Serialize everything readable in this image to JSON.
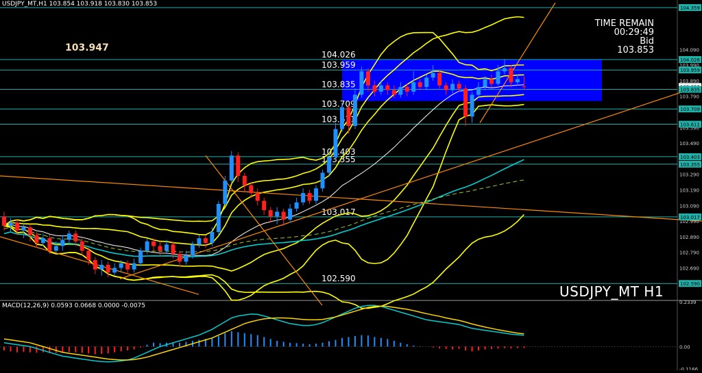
{
  "header": {
    "symbol_info": "USDJPY_MT,H1  103.854 103.918 103.830 103.853",
    "macd_info": "MACD(12,26,9) 0.0593 0.0668 0.0000 -0.0075"
  },
  "overlay": {
    "big_price": "103.947",
    "time_remain_label": "TIME REMAIN",
    "time_remain_value": "00:29:49",
    "bid_label": "Bid",
    "bid_value": "103.853",
    "symbol_label": "USDJPY_MT H1"
  },
  "colors": {
    "background": "#000000",
    "bull": "#1e90ff",
    "bear": "#ff2020",
    "bollinger": "#ffff00",
    "level_line": "#20b2aa",
    "trend_line": "#ff8c00",
    "ma_cyan": "#00ced1",
    "macd_histogram_pos": "#1e90ff",
    "macd_histogram_neg": "#ff2020",
    "highlight_box": "#0000ff"
  },
  "chart_data": [
    {
      "type": "candlestick",
      "title": "USDJPY_MT H1",
      "ylim": [
        102.49,
        104.39
      ],
      "price_axis_ticks": [
        "104.359",
        "104.090",
        "103.990",
        "103.890",
        "103.790",
        "103.590",
        "103.490",
        "103.290",
        "103.190",
        "103.090",
        "102.990",
        "102.890",
        "102.790",
        "102.690"
      ],
      "level_lines": [
        {
          "value": 104.026,
          "label": "104.026"
        },
        {
          "value": 103.959,
          "label": "103.959"
        },
        {
          "value": 103.835,
          "label": "103.835"
        },
        {
          "value": 103.709,
          "label": "103.709"
        },
        {
          "value": 103.611,
          "label": "103.611"
        },
        {
          "value": 103.403,
          "label": "103.403"
        },
        {
          "value": 103.355,
          "label": "103.355"
        },
        {
          "value": 103.017,
          "label": "103.017"
        },
        {
          "value": 102.59,
          "label": "102.590"
        },
        {
          "value": 104.359,
          "label": "104.359"
        }
      ],
      "axis_level_boxes": [
        "104.359",
        "104.026",
        "103.959",
        "103.853",
        "103.835",
        "103.709",
        "103.611",
        "103.403",
        "103.355",
        "103.017",
        "102.590"
      ],
      "candles": [
        {
          "o": 103.02,
          "c": 102.96,
          "h": 103.05,
          "l": 102.93
        },
        {
          "o": 102.96,
          "c": 102.98,
          "h": 103.01,
          "l": 102.92
        },
        {
          "o": 102.98,
          "c": 102.93,
          "h": 103.0,
          "l": 102.9
        },
        {
          "o": 102.93,
          "c": 102.95,
          "h": 102.98,
          "l": 102.88
        },
        {
          "o": 102.95,
          "c": 102.9,
          "h": 102.97,
          "l": 102.86
        },
        {
          "o": 102.9,
          "c": 102.85,
          "h": 102.92,
          "l": 102.82
        },
        {
          "o": 102.85,
          "c": 102.88,
          "h": 102.91,
          "l": 102.83
        },
        {
          "o": 102.88,
          "c": 102.8,
          "h": 102.9,
          "l": 102.78
        },
        {
          "o": 102.8,
          "c": 102.83,
          "h": 102.86,
          "l": 102.78
        },
        {
          "o": 102.83,
          "c": 102.87,
          "h": 102.9,
          "l": 102.8
        },
        {
          "o": 102.87,
          "c": 102.91,
          "h": 102.93,
          "l": 102.85
        },
        {
          "o": 102.91,
          "c": 102.86,
          "h": 102.93,
          "l": 102.83
        },
        {
          "o": 102.86,
          "c": 102.8,
          "h": 102.88,
          "l": 102.77
        },
        {
          "o": 102.8,
          "c": 102.74,
          "h": 102.82,
          "l": 102.71
        },
        {
          "o": 102.74,
          "c": 102.68,
          "h": 102.76,
          "l": 102.65
        },
        {
          "o": 102.68,
          "c": 102.71,
          "h": 102.74,
          "l": 102.64
        },
        {
          "o": 102.71,
          "c": 102.66,
          "h": 102.73,
          "l": 102.63
        },
        {
          "o": 102.66,
          "c": 102.69,
          "h": 102.72,
          "l": 102.64
        },
        {
          "o": 102.69,
          "c": 102.72,
          "h": 102.74,
          "l": 102.66
        },
        {
          "o": 102.72,
          "c": 102.68,
          "h": 102.74,
          "l": 102.65
        },
        {
          "o": 102.68,
          "c": 102.72,
          "h": 102.75,
          "l": 102.66
        },
        {
          "o": 102.72,
          "c": 102.8,
          "h": 102.82,
          "l": 102.7
        },
        {
          "o": 102.8,
          "c": 102.86,
          "h": 102.88,
          "l": 102.78
        },
        {
          "o": 102.86,
          "c": 102.83,
          "h": 102.88,
          "l": 102.8
        },
        {
          "o": 102.83,
          "c": 102.8,
          "h": 102.86,
          "l": 102.77
        },
        {
          "o": 102.8,
          "c": 102.84,
          "h": 102.87,
          "l": 102.78
        },
        {
          "o": 102.84,
          "c": 102.78,
          "h": 102.86,
          "l": 102.75
        },
        {
          "o": 102.78,
          "c": 102.73,
          "h": 102.8,
          "l": 102.7
        },
        {
          "o": 102.73,
          "c": 102.77,
          "h": 102.8,
          "l": 102.71
        },
        {
          "o": 102.77,
          "c": 102.84,
          "h": 102.86,
          "l": 102.75
        },
        {
          "o": 102.84,
          "c": 102.88,
          "h": 102.9,
          "l": 102.82
        },
        {
          "o": 102.88,
          "c": 102.85,
          "h": 102.9,
          "l": 102.82
        },
        {
          "o": 102.85,
          "c": 102.92,
          "h": 102.95,
          "l": 102.83
        },
        {
          "o": 102.92,
          "c": 103.1,
          "h": 103.12,
          "l": 102.9
        },
        {
          "o": 103.1,
          "c": 103.25,
          "h": 103.28,
          "l": 103.08
        },
        {
          "o": 103.25,
          "c": 103.41,
          "h": 103.44,
          "l": 103.23
        },
        {
          "o": 103.41,
          "c": 103.28,
          "h": 103.43,
          "l": 103.24
        },
        {
          "o": 103.28,
          "c": 103.22,
          "h": 103.3,
          "l": 103.18
        },
        {
          "o": 103.22,
          "c": 103.17,
          "h": 103.24,
          "l": 103.14
        },
        {
          "o": 103.17,
          "c": 103.12,
          "h": 103.2,
          "l": 103.09
        },
        {
          "o": 103.12,
          "c": 103.06,
          "h": 103.14,
          "l": 103.03
        },
        {
          "o": 103.06,
          "c": 103.02,
          "h": 103.08,
          "l": 102.98
        },
        {
          "o": 103.02,
          "c": 103.05,
          "h": 103.08,
          "l": 102.97
        },
        {
          "o": 103.05,
          "c": 103.0,
          "h": 103.07,
          "l": 102.96
        },
        {
          "o": 103.0,
          "c": 103.07,
          "h": 103.1,
          "l": 102.98
        },
        {
          "o": 103.07,
          "c": 103.11,
          "h": 103.14,
          "l": 103.05
        },
        {
          "o": 103.11,
          "c": 103.17,
          "h": 103.2,
          "l": 103.09
        },
        {
          "o": 103.17,
          "c": 103.12,
          "h": 103.19,
          "l": 103.1
        },
        {
          "o": 103.12,
          "c": 103.2,
          "h": 103.22,
          "l": 103.1
        },
        {
          "o": 103.2,
          "c": 103.3,
          "h": 103.32,
          "l": 103.18
        },
        {
          "o": 103.3,
          "c": 103.4,
          "h": 103.43,
          "l": 103.28
        },
        {
          "o": 103.4,
          "c": 103.58,
          "h": 103.62,
          "l": 103.38
        },
        {
          "o": 103.58,
          "c": 103.72,
          "h": 103.75,
          "l": 103.56
        },
        {
          "o": 103.72,
          "c": 103.6,
          "h": 103.74,
          "l": 103.55
        },
        {
          "o": 103.6,
          "c": 103.8,
          "h": 103.84,
          "l": 103.58
        },
        {
          "o": 103.8,
          "c": 103.95,
          "h": 103.98,
          "l": 103.78
        },
        {
          "o": 103.95,
          "c": 103.86,
          "h": 103.97,
          "l": 103.82
        },
        {
          "o": 103.86,
          "c": 103.82,
          "h": 103.89,
          "l": 103.79
        },
        {
          "o": 103.82,
          "c": 103.86,
          "h": 103.89,
          "l": 103.8
        },
        {
          "o": 103.86,
          "c": 103.83,
          "h": 103.88,
          "l": 103.8
        },
        {
          "o": 103.83,
          "c": 103.8,
          "h": 103.86,
          "l": 103.78
        },
        {
          "o": 103.8,
          "c": 103.85,
          "h": 103.88,
          "l": 103.78
        },
        {
          "o": 103.85,
          "c": 103.82,
          "h": 103.87,
          "l": 103.79
        },
        {
          "o": 103.82,
          "c": 103.88,
          "h": 103.95,
          "l": 103.8
        },
        {
          "o": 103.88,
          "c": 103.85,
          "h": 103.9,
          "l": 103.83
        },
        {
          "o": 103.85,
          "c": 103.91,
          "h": 103.93,
          "l": 103.83
        },
        {
          "o": 103.91,
          "c": 103.94,
          "h": 103.99,
          "l": 103.89
        },
        {
          "o": 103.94,
          "c": 103.86,
          "h": 103.96,
          "l": 103.84
        },
        {
          "o": 103.86,
          "c": 103.83,
          "h": 103.88,
          "l": 103.8
        },
        {
          "o": 103.83,
          "c": 103.87,
          "h": 103.9,
          "l": 103.81
        },
        {
          "o": 103.87,
          "c": 103.84,
          "h": 103.89,
          "l": 103.82
        },
        {
          "o": 103.84,
          "c": 103.66,
          "h": 103.86,
          "l": 103.6
        },
        {
          "o": 103.66,
          "c": 103.8,
          "h": 103.82,
          "l": 103.62
        },
        {
          "o": 103.8,
          "c": 103.85,
          "h": 103.88,
          "l": 103.78
        },
        {
          "o": 103.85,
          "c": 103.9,
          "h": 103.92,
          "l": 103.83
        },
        {
          "o": 103.9,
          "c": 103.87,
          "h": 103.93,
          "l": 103.85
        },
        {
          "o": 103.87,
          "c": 103.95,
          "h": 103.99,
          "l": 103.86
        },
        {
          "o": 103.95,
          "c": 103.97,
          "h": 104.03,
          "l": 103.93
        },
        {
          "o": 103.97,
          "c": 103.88,
          "h": 103.99,
          "l": 103.85
        },
        {
          "o": 103.88,
          "c": 103.9,
          "h": 103.93,
          "l": 103.86
        },
        {
          "o": 103.854,
          "c": 103.853,
          "h": 103.918,
          "l": 103.83
        }
      ]
    },
    {
      "type": "bar",
      "title": "MACD(12,26,9)",
      "ylim": [
        -0.1166,
        0.2339
      ],
      "axis_ticks": [
        "0.2339",
        "0.00",
        "-0.1166"
      ],
      "histogram": [
        -0.02,
        -0.025,
        -0.03,
        -0.028,
        -0.03,
        -0.032,
        -0.03,
        -0.035,
        -0.033,
        -0.03,
        -0.028,
        -0.03,
        -0.033,
        -0.036,
        -0.04,
        -0.038,
        -0.036,
        -0.03,
        -0.025,
        -0.02,
        -0.015,
        -0.005,
        0.01,
        0.02,
        0.018,
        0.02,
        0.022,
        0.02,
        0.025,
        0.03,
        0.035,
        0.04,
        0.045,
        0.055,
        0.07,
        0.08,
        0.075,
        0.07,
        0.065,
        0.06,
        0.05,
        0.04,
        0.03,
        0.025,
        0.02,
        0.018,
        0.015,
        0.012,
        0.015,
        0.02,
        0.028,
        0.035,
        0.045,
        0.05,
        0.055,
        0.06,
        0.058,
        0.05,
        0.045,
        0.04,
        0.03,
        0.02,
        0.012,
        0.005,
        0.002,
        0.0,
        -0.005,
        -0.01,
        -0.012,
        -0.015,
        -0.012,
        -0.02,
        -0.025,
        -0.02,
        -0.015,
        -0.012,
        -0.01,
        -0.008,
        -0.01,
        -0.008,
        -0.0075
      ],
      "series": [
        {
          "name": "MACD",
          "values": [
            0.02,
            0.015,
            0.01,
            0.005,
            0.0,
            -0.01,
            -0.02,
            -0.03,
            -0.04,
            -0.05,
            -0.055,
            -0.06,
            -0.065,
            -0.07,
            -0.075,
            -0.078,
            -0.08,
            -0.078,
            -0.075,
            -0.07,
            -0.06,
            -0.045,
            -0.03,
            -0.015,
            0.0,
            0.01,
            0.02,
            0.03,
            0.04,
            0.05,
            0.06,
            0.075,
            0.09,
            0.11,
            0.13,
            0.15,
            0.16,
            0.165,
            0.17,
            0.168,
            0.16,
            0.15,
            0.14,
            0.13,
            0.12,
            0.115,
            0.11,
            0.11,
            0.115,
            0.125,
            0.14,
            0.155,
            0.17,
            0.185,
            0.2,
            0.21,
            0.215,
            0.215,
            0.21,
            0.2,
            0.19,
            0.18,
            0.17,
            0.16,
            0.15,
            0.14,
            0.135,
            0.13,
            0.125,
            0.12,
            0.115,
            0.105,
            0.095,
            0.09,
            0.085,
            0.08,
            0.075,
            0.07,
            0.065,
            0.062,
            0.0593
          ]
        },
        {
          "name": "Signal",
          "values": [
            0.04,
            0.035,
            0.03,
            0.025,
            0.02,
            0.01,
            0.0,
            -0.01,
            -0.02,
            -0.03,
            -0.035,
            -0.04,
            -0.045,
            -0.05,
            -0.055,
            -0.06,
            -0.065,
            -0.068,
            -0.07,
            -0.07,
            -0.068,
            -0.062,
            -0.055,
            -0.045,
            -0.035,
            -0.025,
            -0.015,
            -0.005,
            0.005,
            0.015,
            0.025,
            0.035,
            0.045,
            0.06,
            0.075,
            0.09,
            0.105,
            0.12,
            0.13,
            0.138,
            0.145,
            0.148,
            0.15,
            0.15,
            0.148,
            0.145,
            0.142,
            0.14,
            0.14,
            0.142,
            0.148,
            0.155,
            0.165,
            0.175,
            0.185,
            0.195,
            0.205,
            0.21,
            0.212,
            0.21,
            0.205,
            0.2,
            0.195,
            0.188,
            0.18,
            0.172,
            0.165,
            0.158,
            0.15,
            0.143,
            0.137,
            0.128,
            0.118,
            0.11,
            0.102,
            0.095,
            0.088,
            0.082,
            0.076,
            0.07,
            0.0668
          ]
        }
      ]
    }
  ]
}
